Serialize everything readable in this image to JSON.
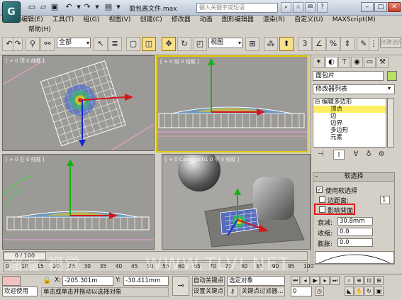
{
  "title": {
    "document": "面包酱文件.max",
    "search_placeholder": "键入关键字或短语"
  },
  "menu": [
    "编辑(E)",
    "工具(T)",
    "组(G)",
    "视图(V)",
    "创建(C)",
    "修改器",
    "动画",
    "图形编辑器",
    "渲染(R)",
    "自定义(U)",
    "MAXScript(M)"
  ],
  "menu_row2": [
    "帮助(H)"
  ],
  "toolbar": {
    "selection_filter": "全部",
    "ref_coord": "视图",
    "named_selection": "创建选择"
  },
  "viewports": {
    "top": "[ + 0 顶 0 线框 ]",
    "front": "[ + 0 前 0 线框 ]",
    "left": "[ + 0 左 0 线框 ]",
    "persp": "[ + 0 Camera001 0 平 0 线框 ]"
  },
  "command_panel": {
    "object_name": "面包片",
    "object_color": "#b8e060",
    "modifier_list": "修改器列表",
    "stack": [
      {
        "label": "⊟ 编辑多边形",
        "indent": 0,
        "selected": false
      },
      {
        "label": "顶点",
        "indent": 1,
        "selected": true
      },
      {
        "label": "边",
        "indent": 1,
        "selected": false
      },
      {
        "label": "边界",
        "indent": 1,
        "selected": false
      },
      {
        "label": "多边形",
        "indent": 1,
        "selected": false
      },
      {
        "label": "元素",
        "indent": 1,
        "selected": false
      }
    ],
    "rollout_title": "软选择",
    "use_soft_select": "使用软选择",
    "edge_distance": "边距离:",
    "edge_distance_value": "1",
    "affect_backfacing": "影响背面",
    "falloff_label": "衰减:",
    "falloff_value": "30.8mm",
    "pinch_label": "收缩:",
    "pinch_value": "0.0",
    "bubble_label": "膨胀:",
    "bubble_value": "0.0"
  },
  "timeline": {
    "slider": "0 / 100",
    "ticks": [
      "0",
      "10",
      "15",
      "20",
      "25",
      "30",
      "35",
      "40",
      "45",
      "50",
      "55",
      "60",
      "65",
      "70",
      "75",
      "80",
      "85",
      "90",
      "95",
      "100"
    ]
  },
  "status": {
    "welcome": "欢迎使用",
    "x_label": "X:",
    "x_value": "-205.301m",
    "y_label": "Y:",
    "y_value": "-30.411mm",
    "prompt": "单击或单击并拖动以选择对象",
    "auto_key": "自动关键点",
    "selected_dropdown": "选定对象",
    "set_key": "设置关键点",
    "key_filters": "关键点过滤器...",
    "frame": "0"
  },
  "watermark": "溜溜·视觉",
  "watermark2": "WWW.TLVI.NET"
}
